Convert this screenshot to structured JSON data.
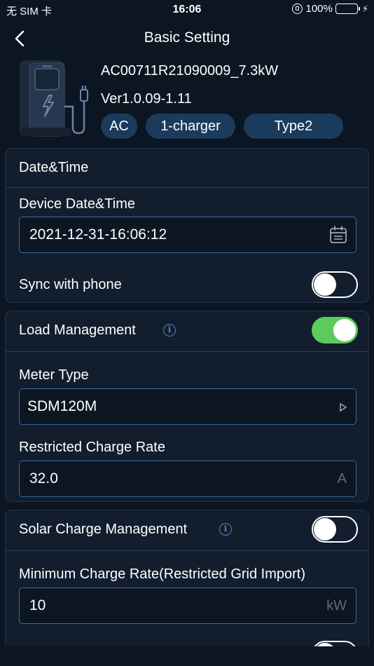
{
  "status": {
    "carrier": "无 SIM 卡",
    "time": "16:06",
    "battery": "100%"
  },
  "nav": {
    "title": "Basic Setting"
  },
  "device": {
    "name": "AC00711R21090009_7.3kW",
    "version": "Ver1.0.09-1.11",
    "tags": [
      "AC",
      "1-charger",
      "Type2"
    ]
  },
  "datetime": {
    "title": "Date&Time",
    "device_label": "Device Date&Time",
    "device_value": "2021-12-31-16:06:12",
    "sync_label": "Sync with phone",
    "sync_on": false
  },
  "load": {
    "title": "Load Management",
    "enabled": true,
    "meter_label": "Meter Type",
    "meter_value": "SDM120M",
    "rate_label": "Restricted Charge Rate",
    "rate_value": "32.0",
    "rate_unit": "A"
  },
  "solar": {
    "title": "Solar Charge Management",
    "enabled": false,
    "min_label": "Minimum Charge Rate(Restricted Grid Import)",
    "min_value": "10",
    "min_unit": "kW"
  },
  "colors": {
    "background": "#0c1522",
    "card": "#121e2e",
    "accent": "#3b6aa0",
    "toggle_on": "#5ec95c",
    "tag": "#1b3b5c"
  }
}
